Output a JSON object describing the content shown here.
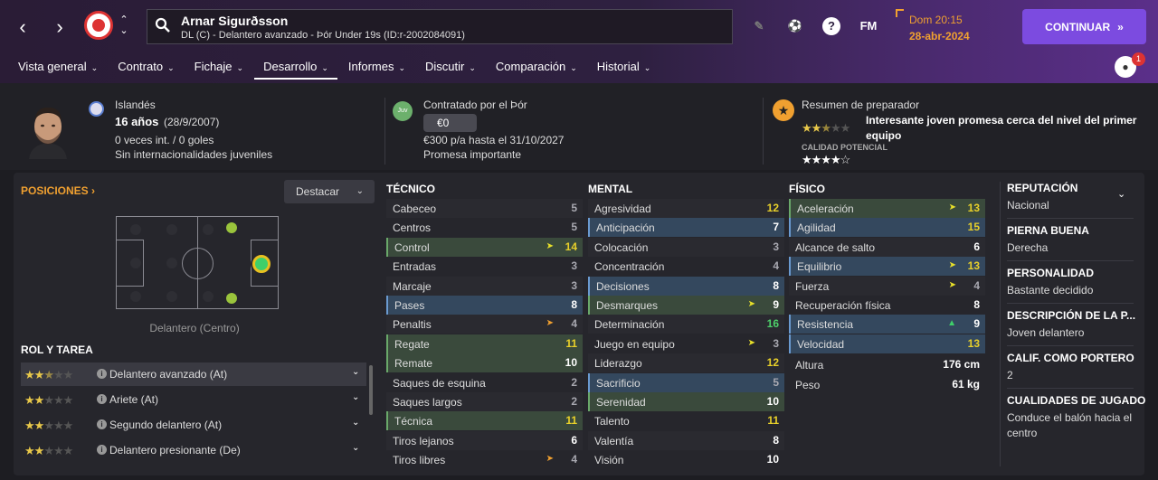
{
  "header": {
    "player_name": "Arnar Sigurðsson",
    "player_sub": "DL (C) - Delantero avanzado - Þór Under 19s (ID:r-2002084091)",
    "time": "Dom 20:15",
    "date": "28-abr-2024",
    "continue_label": "CONTINUAR",
    "fm_label": "FM",
    "notifications": "1"
  },
  "menu": [
    {
      "label": "Vista general"
    },
    {
      "label": "Contrato"
    },
    {
      "label": "Fichaje"
    },
    {
      "label": "Desarrollo"
    },
    {
      "label": "Informes"
    },
    {
      "label": "Discutir"
    },
    {
      "label": "Comparación"
    },
    {
      "label": "Historial"
    }
  ],
  "info": {
    "nationality": "Islandés",
    "age": "16 años",
    "dob": "(28/9/2007)",
    "caps": "0 veces int. / 0 goles",
    "youth_caps": "Sin internacionalidades juveniles",
    "juv_badge": "Juv",
    "contract_title": "Contratado por el Þór",
    "fee": "€0",
    "contract_terms": "€300 p/a hasta el 31/10/2027",
    "status": "Promesa importante",
    "coach_title": "Resumen de preparador",
    "coach_summary": "Interesante joven promesa cerca del nivel del primer equipo",
    "potential_label": "CALIDAD POTENCIAL",
    "current_ability_stars": 2.5,
    "potential_stars": 4.0
  },
  "positions": {
    "title": "POSICIONES",
    "highlight_label": "Destacar",
    "position_label": "Delantero (Centro)"
  },
  "roles": {
    "title": "ROL Y TAREA",
    "items": [
      {
        "name": "Delantero avanzado (At)",
        "stars": 2.5
      },
      {
        "name": "Ariete (At)",
        "stars": 2
      },
      {
        "name": "Segundo delantero (At)",
        "stars": 2
      },
      {
        "name": "Delantero presionante (De)",
        "stars": 2
      }
    ]
  },
  "tecnico": {
    "title": "TÉCNICO",
    "rows": [
      {
        "name": "Cabeceo",
        "value": "5"
      },
      {
        "name": "Centros",
        "value": "5"
      },
      {
        "name": "Control",
        "value": "14",
        "trend": "up"
      },
      {
        "name": "Entradas",
        "value": "3"
      },
      {
        "name": "Marcaje",
        "value": "3"
      },
      {
        "name": "Pases",
        "value": "8"
      },
      {
        "name": "Penaltis",
        "value": "4",
        "trend": "down"
      },
      {
        "name": "Regate",
        "value": "11"
      },
      {
        "name": "Remate",
        "value": "10"
      },
      {
        "name": "Saques de esquina",
        "value": "2"
      },
      {
        "name": "Saques largos",
        "value": "2"
      },
      {
        "name": "Técnica",
        "value": "11"
      },
      {
        "name": "Tiros lejanos",
        "value": "6"
      },
      {
        "name": "Tiros libres",
        "value": "4",
        "trend": "down"
      }
    ]
  },
  "mental": {
    "title": "MENTAL",
    "rows": [
      {
        "name": "Agresividad",
        "value": "12"
      },
      {
        "name": "Anticipación",
        "value": "7"
      },
      {
        "name": "Colocación",
        "value": "3"
      },
      {
        "name": "Concentración",
        "value": "4"
      },
      {
        "name": "Decisiones",
        "value": "8"
      },
      {
        "name": "Desmarques",
        "value": "9",
        "trend": "up"
      },
      {
        "name": "Determinación",
        "value": "16"
      },
      {
        "name": "Juego en equipo",
        "value": "3",
        "trend": "up"
      },
      {
        "name": "Liderazgo",
        "value": "12"
      },
      {
        "name": "Sacrificio",
        "value": "5"
      },
      {
        "name": "Serenidad",
        "value": "10"
      },
      {
        "name": "Talento",
        "value": "11"
      },
      {
        "name": "Valentía",
        "value": "8"
      },
      {
        "name": "Visión",
        "value": "10"
      }
    ]
  },
  "fisico": {
    "title": "FÍSICO",
    "rows": [
      {
        "name": "Aceleración",
        "value": "13",
        "trend": "up"
      },
      {
        "name": "Agilidad",
        "value": "15"
      },
      {
        "name": "Alcance de salto",
        "value": "6"
      },
      {
        "name": "Equilibrio",
        "value": "13",
        "trend": "up"
      },
      {
        "name": "Fuerza",
        "value": "4",
        "trend": "up"
      },
      {
        "name": "Recuperación física",
        "value": "8"
      },
      {
        "name": "Resistencia",
        "value": "9",
        "trend": "upgreen"
      },
      {
        "name": "Velocidad",
        "value": "13"
      }
    ],
    "height_label": "Altura",
    "height": "176 cm",
    "weight_label": "Peso",
    "weight": "61 kg"
  },
  "side": [
    {
      "label": "REPUTACIÓN",
      "value": "Nacional"
    },
    {
      "label": "PIERNA BUENA",
      "value": "Derecha"
    },
    {
      "label": "PERSONALIDAD",
      "value": "Bastante decidido"
    },
    {
      "label": "DESCRIPCIÓN DE LA P...",
      "value": "Joven delantero"
    },
    {
      "label": "CALIF. COMO PORTERO",
      "value": "2"
    },
    {
      "label": "CUALIDADES DE JUGADO",
      "value": "Conduce el balón hacia el centro"
    }
  ]
}
